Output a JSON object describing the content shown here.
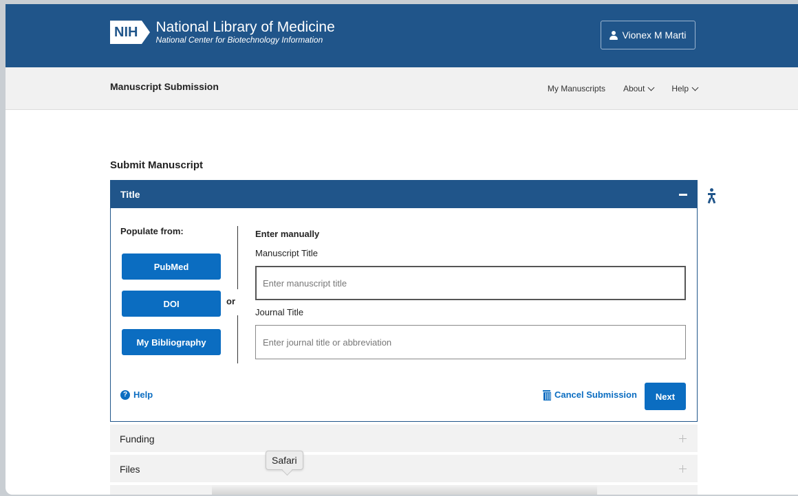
{
  "header": {
    "logo_abbr": "NIH",
    "title": "National Library of Medicine",
    "subtitle": "National Center for Biotechnology Information",
    "user_name": "Vionex M Marti"
  },
  "subnav": {
    "title": "Manuscript Submission",
    "links": [
      {
        "label": "My Manuscripts"
      },
      {
        "label": "About"
      },
      {
        "label": "Help"
      }
    ]
  },
  "page": {
    "heading": "Submit Manuscript"
  },
  "panel": {
    "title": "Title",
    "populate_label": "Populate from:",
    "buttons": [
      {
        "label": "PubMed"
      },
      {
        "label": "DOI"
      },
      {
        "label": "My Bibliography"
      }
    ],
    "or_label": "or",
    "enter_manually": "Enter manually",
    "manuscript_title_label": "Manuscript Title",
    "manuscript_title_placeholder": "Enter manuscript title",
    "journal_title_label": "Journal Title",
    "journal_title_placeholder": "Enter journal title or abbreviation",
    "help_label": "Help",
    "cancel_label": "Cancel Submission",
    "next_label": "Next"
  },
  "sections": [
    {
      "label": "Funding"
    },
    {
      "label": "Files"
    }
  ],
  "tooltip": {
    "text": "Safari"
  },
  "colors": {
    "header_blue": "#20558a",
    "button_blue": "#0b6dc1"
  }
}
